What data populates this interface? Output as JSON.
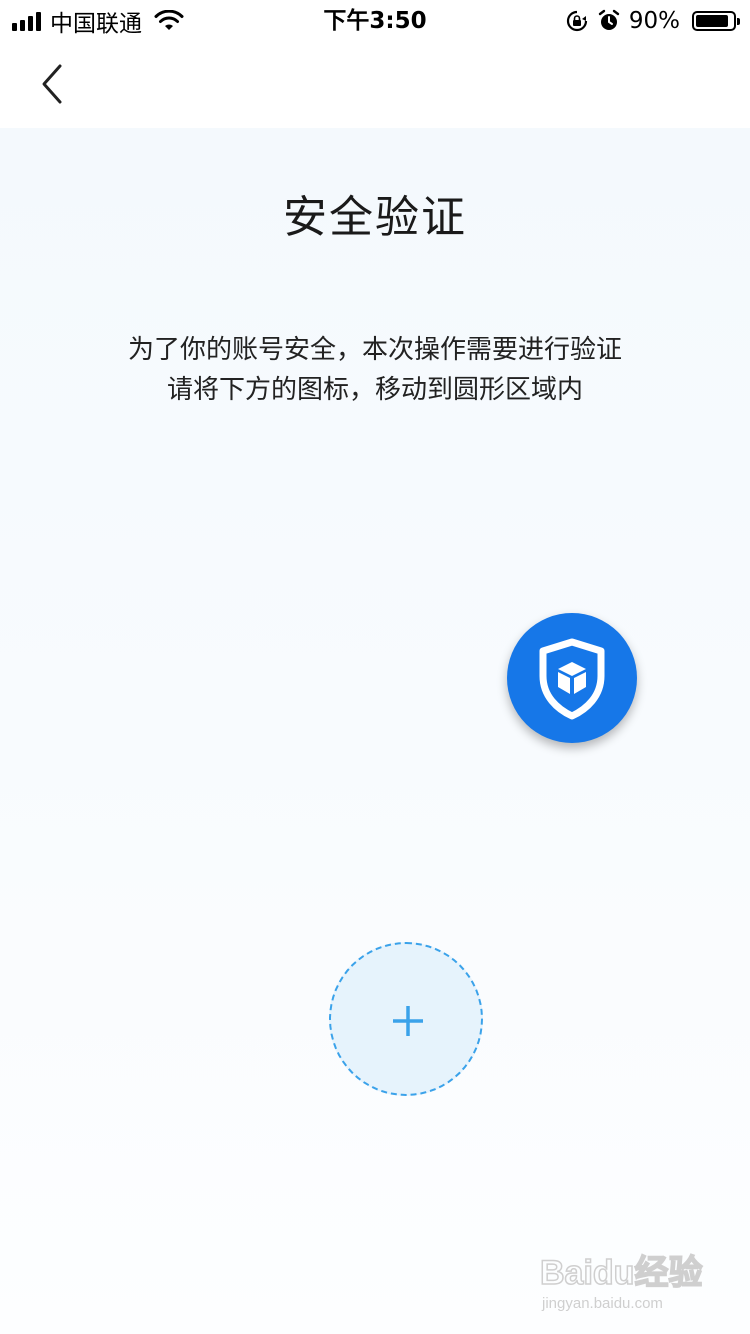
{
  "status_bar": {
    "carrier": "中国联通",
    "time": "下午3:50",
    "battery_percent_label": "90%",
    "battery_level": 0.9,
    "icons": [
      "signal-icon",
      "wifi-icon",
      "orientation-lock-icon",
      "alarm-icon",
      "battery-icon"
    ]
  },
  "nav": {
    "back_icon": "chevron-left-icon"
  },
  "page": {
    "title": "安全验证",
    "instruction_line1": "为了你的账号安全，本次操作需要进行验证",
    "instruction_line2": "请将下方的图标，移动到圆形区域内"
  },
  "widgets": {
    "drag_token_icon": "shield-cube-icon",
    "drop_target_icon": "plus-icon"
  },
  "watermark": {
    "text": "Baidu经验",
    "subtext": "jingyan.baidu.com"
  },
  "colors": {
    "token_blue": "#1677e8",
    "drop_border": "#3aa2ea",
    "drop_fill": "#e6f3fc",
    "background_tint": "#f4f9fd"
  }
}
